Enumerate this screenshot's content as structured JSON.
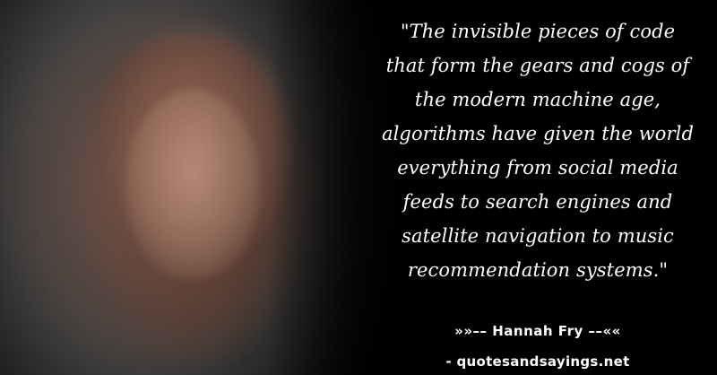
{
  "quote": {
    "lines": [
      "\"The invisible pieces of code",
      "that form the gears and cogs of",
      "the modern machine age,",
      "algorithms have given the world",
      "everything from social media",
      "feeds to search engines and",
      "satellite navigation to music",
      "recommendation systems.\""
    ]
  },
  "attribution": {
    "author": "»»–– Hannah Fry ––««",
    "source": "- quotesandsayings.net"
  },
  "colors": {
    "background": "#000000",
    "text": "#ffffff"
  }
}
